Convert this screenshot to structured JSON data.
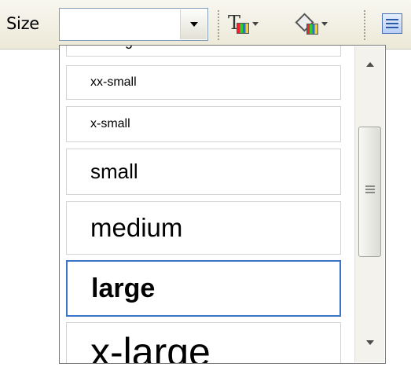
{
  "toolbar": {
    "size_label": "Size",
    "size_value": "",
    "icons": [
      "text-color-icon",
      "background-color-icon",
      "list-icon"
    ]
  },
  "dropdown": {
    "items": [
      {
        "label": "xx-large"
      },
      {
        "label": "xx-small"
      },
      {
        "label": "x-small"
      },
      {
        "label": "small"
      },
      {
        "label": "medium"
      },
      {
        "label": "large",
        "selected": true
      },
      {
        "label": "x-large"
      }
    ]
  },
  "colors": {
    "accent": "#3b74c9",
    "toolbar_bg": "#ece9d8"
  }
}
